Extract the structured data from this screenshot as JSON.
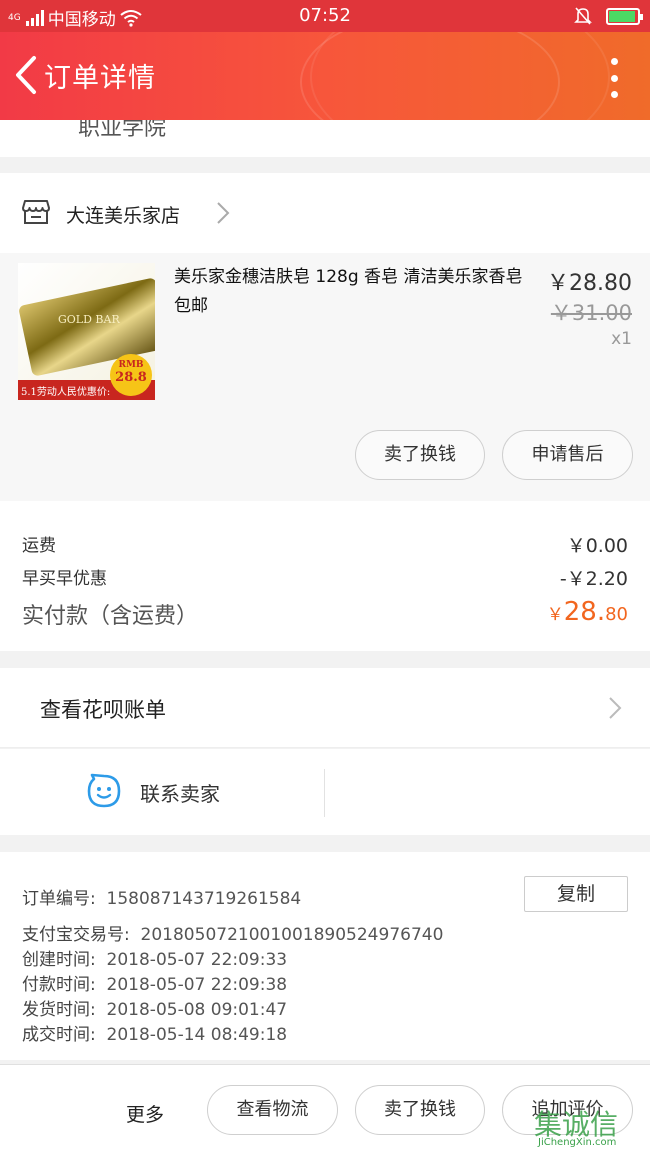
{
  "status_bar": {
    "network": "4G",
    "carrier": "中国移动",
    "time": "07:52"
  },
  "header": {
    "title": "订单详情"
  },
  "partial_text": "职业学院",
  "store": {
    "name": "大连美乐家店"
  },
  "product": {
    "title": "美乐家金穗洁肤皂 128g 香皂 清洁美乐家香皂 包邮",
    "price": "￥28.80",
    "original_price": "￥31.00",
    "quantity": "x1",
    "image_text": {
      "brand": "GOLD BAR",
      "promo": "5.1劳动人民优惠价:",
      "badge_top": "RMB",
      "badge_value": "28.8"
    },
    "buttons": {
      "sell": "卖了换钱",
      "after_sale": "申请售后"
    }
  },
  "fees": {
    "shipping_label": "运费",
    "shipping_value": "￥0.00",
    "discount_label": "早买早优惠",
    "discount_value": "-￥2.20",
    "total_label": "实付款（含运费）",
    "total_currency": "￥",
    "total_integer": "28.",
    "total_cents": "80"
  },
  "huabei": {
    "label": "查看花呗账单"
  },
  "contact": {
    "label": "联系卖家"
  },
  "order_info": {
    "order_no_label": "订单编号:",
    "order_no": "1580871437192615​84",
    "copy_label": "复制",
    "alipay_label": "支付宝交易号:",
    "alipay_no": "2018050721001001890524976740",
    "created_label": "创建时间:",
    "created": "2018-05-07 22:09:33",
    "paid_label": "付款时间:",
    "paid": "2018-05-07 22:09:38",
    "shipped_label": "发货时间:",
    "shipped": "2018-05-08 09:01:47",
    "completed_label": "成交时间:",
    "completed": "2018-05-14 08:49:18"
  },
  "bottom_bar": {
    "more": "更多",
    "logistics": "查看物流",
    "sell": "卖了换钱",
    "review": "追加评价"
  },
  "watermark": {
    "big": "集诚信",
    "small": "JiChengXin.com"
  },
  "colors": {
    "header_start": "#f23a46",
    "header_end": "#f06b2a",
    "accent_price": "#f2661f",
    "status_bar": "#e0353a"
  }
}
